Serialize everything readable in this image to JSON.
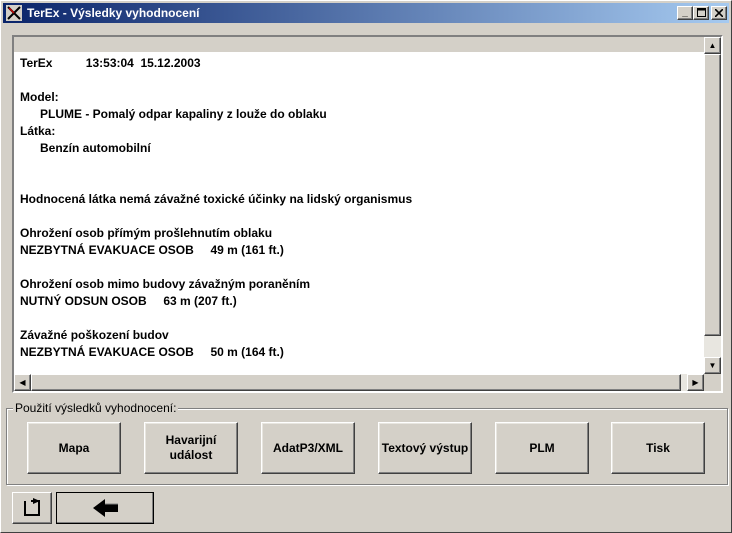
{
  "window": {
    "title": "TerEx - Výsledky vyhodnocení"
  },
  "report": {
    "lines": [
      {
        "text": "TerEx          13:53:04  15.12.2003",
        "indent": false
      },
      {
        "text": "Model:",
        "indent": false
      },
      {
        "text": "PLUME - Pomalý odpar kapaliny z louže do oblaku",
        "indent": true
      },
      {
        "text": "Látka:",
        "indent": false
      },
      {
        "text": "Benzín automobilní",
        "indent": true
      },
      {
        "text": "Hodnocená látka nemá závažné toxické účinky na lidský organismus",
        "indent": false
      },
      {
        "text": "Ohrožení osob přímým prošlehnutím oblaku",
        "indent": false
      },
      {
        "text": "NEZBYTNÁ EVAKUACE OSOB     49 m (161 ft.)",
        "indent": false
      },
      {
        "text": "Ohrožení osob mimo budovy závažným poraněním",
        "indent": false
      },
      {
        "text": "NUTNÝ ODSUN OSOB     63 m (207 ft.)",
        "indent": false
      },
      {
        "text": "Závažné poškození budov",
        "indent": false
      },
      {
        "text": "NEZBYTNÁ EVAKUACE OSOB     50 m (164 ft.)",
        "indent": false
      }
    ]
  },
  "usage_group": {
    "label": "Použití výsledků vyhodnocení:",
    "buttons": [
      {
        "label": "Mapa"
      },
      {
        "label": "Havarijní\nudálost"
      },
      {
        "label": "AdatP3/XML"
      },
      {
        "label": "Textový výstup"
      },
      {
        "label": "PLM"
      },
      {
        "label": "Tisk"
      }
    ]
  },
  "icons": {
    "app": "terex-app-icon",
    "minimize": "minimize-icon",
    "maximize": "maximize-icon",
    "close": "close-icon",
    "refresh": "refresh-icon",
    "back": "back-arrow-icon"
  }
}
